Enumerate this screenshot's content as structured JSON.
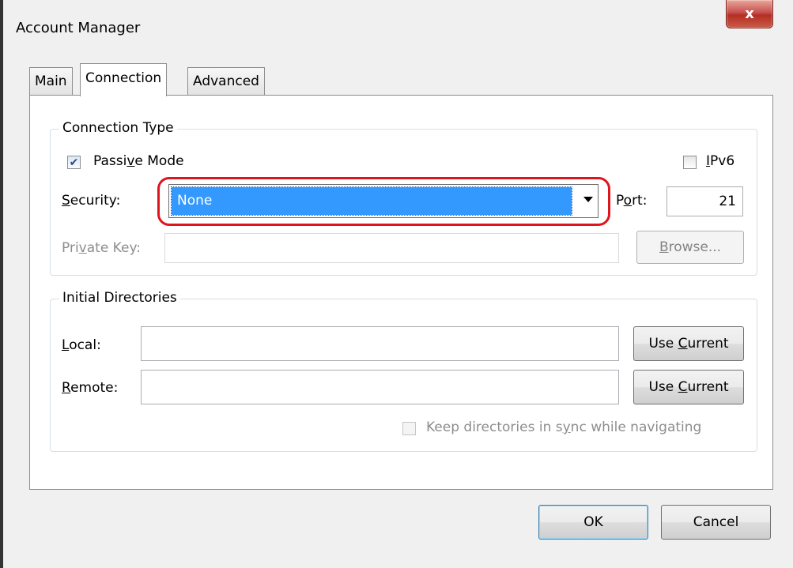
{
  "window": {
    "title": "Account Manager",
    "close_glyph": "x"
  },
  "tabs": [
    {
      "label": "Main",
      "active": false
    },
    {
      "label": "Connection",
      "active": true
    },
    {
      "label": "Advanced",
      "active": false
    }
  ],
  "connection_type": {
    "legend": "Connection Type",
    "passive_mode": {
      "pre": "Passi",
      "mnemonic": "v",
      "post": "e Mode",
      "checked": true
    },
    "ipv6": {
      "pre": "",
      "mnemonic": "I",
      "post": "Pv6",
      "checked": false
    },
    "security": {
      "label_mnemonic": "S",
      "label_rest": "ecurity:",
      "selected": "None",
      "highlight_color": "#e0141c"
    },
    "port": {
      "label_pre": "P",
      "label_mnemonic": "o",
      "label_post": "rt:",
      "value": "21"
    },
    "private_key": {
      "label_pre": "Pri",
      "label_mnemonic": "v",
      "label_post": "ate Key:",
      "value": ""
    },
    "browse": {
      "mnemonic": "B",
      "rest": "rowse..."
    }
  },
  "initial_directories": {
    "legend": "Initial Directories",
    "local": {
      "label_mnemonic": "L",
      "label_rest": "ocal:",
      "value": ""
    },
    "remote": {
      "label_mnemonic": "R",
      "label_rest": "emote:",
      "value": ""
    },
    "use_current": {
      "pre": "Use ",
      "mnemonic": "C",
      "post": "urrent"
    },
    "sync": {
      "pre": "Keep directories in s",
      "mnemonic": "y",
      "post": "nc while navigating",
      "checked": false
    }
  },
  "footer": {
    "ok_label": "OK",
    "cancel_label": "Cancel"
  },
  "colors": {
    "selection": "#3399ff",
    "close_button": "#c75050"
  }
}
